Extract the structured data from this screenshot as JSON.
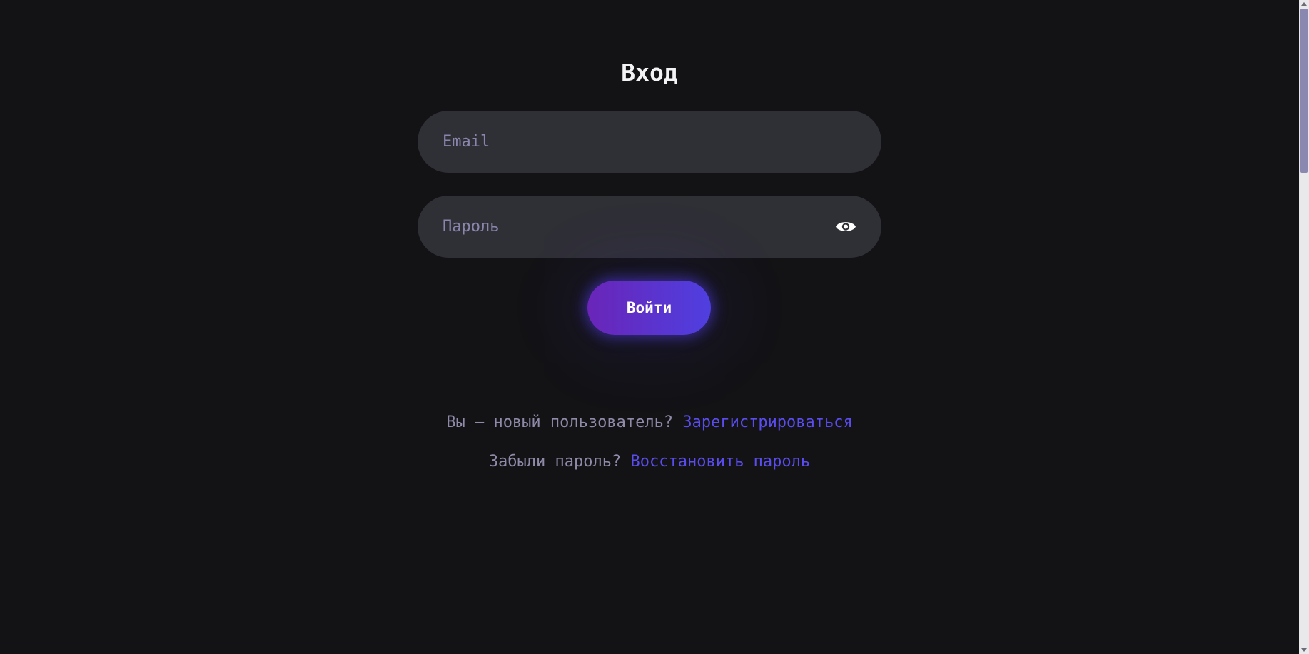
{
  "login": {
    "title": "Вход",
    "email_placeholder": "Email",
    "password_placeholder": "Пароль",
    "submit_label": "Войти"
  },
  "links": {
    "register_prompt": "Вы — новый пользователь?",
    "register_link": "Зарегистрироваться",
    "forgot_prompt": "Забыли пароль?",
    "forgot_link": "Восстановить пароль"
  },
  "icons": {
    "password_toggle": "eye-icon"
  },
  "colors": {
    "background": "#131316",
    "field": "#2f2f36",
    "accent_link": "#5a4df0",
    "button_gradient_start": "#6a25b8",
    "button_gradient_end": "#4f3fe0"
  }
}
